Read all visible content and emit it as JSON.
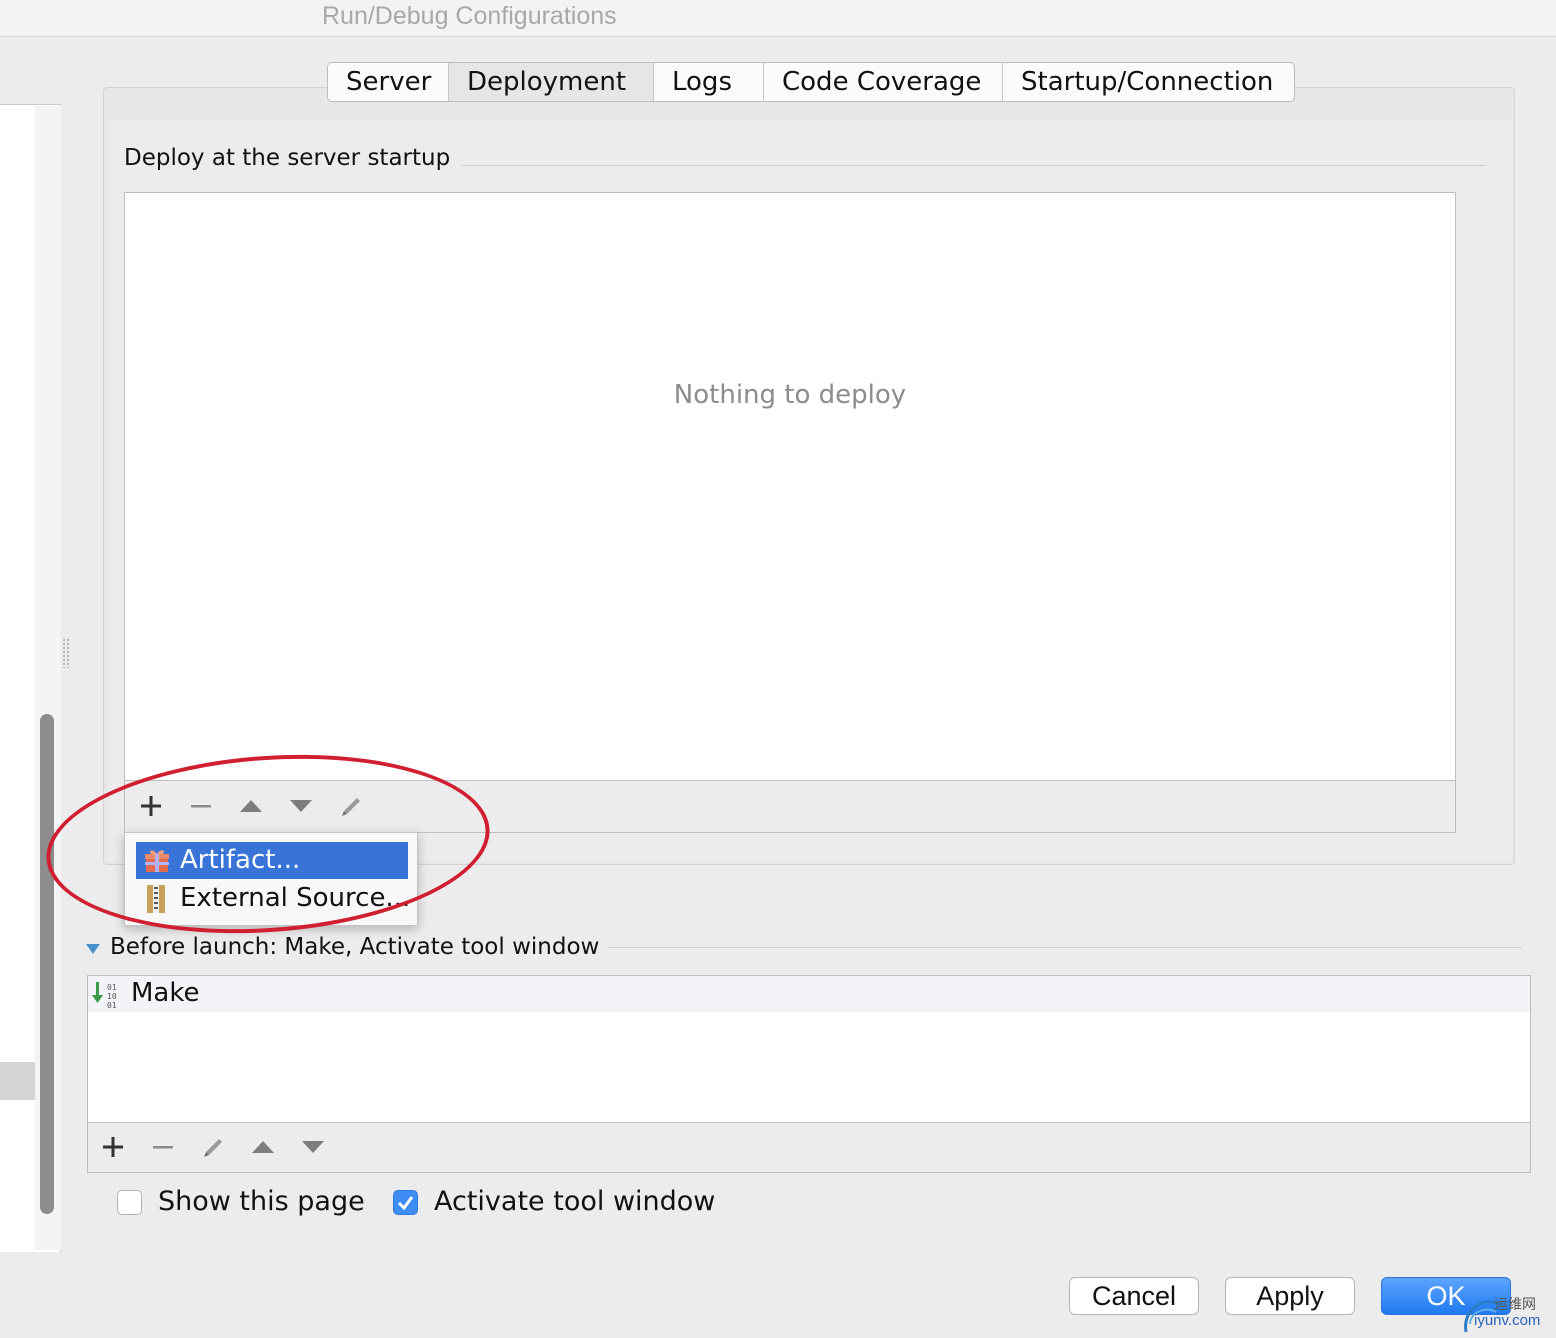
{
  "window": {
    "title": "Run/Debug Configurations"
  },
  "tabs": [
    {
      "label": "Server",
      "selected": false
    },
    {
      "label": "Deployment",
      "selected": true
    },
    {
      "label": "Logs",
      "selected": false
    },
    {
      "label": "Code Coverage",
      "selected": false
    },
    {
      "label": "Startup/Connection",
      "selected": false
    }
  ],
  "deploy": {
    "section_title": "Deploy at the server startup",
    "empty_text": "Nothing to deploy",
    "toolbar_icons": [
      "plus-icon",
      "minus-icon",
      "move-up-icon",
      "move-down-icon",
      "pencil-icon"
    ],
    "add_menu": {
      "items": [
        {
          "label": "Artifact...",
          "icon": "artifact-gift-icon",
          "highlighted": true
        },
        {
          "label": "External Source...",
          "icon": "archive-zip-icon",
          "highlighted": false
        }
      ]
    }
  },
  "before_launch": {
    "title": "Before launch: Make, Activate tool window",
    "items": [
      {
        "label": "Make",
        "icon": "make-build-icon"
      }
    ],
    "toolbar_icons": [
      "plus-icon",
      "minus-icon",
      "pencil-icon",
      "move-up-icon",
      "move-down-icon"
    ]
  },
  "options": {
    "show_page": {
      "label": "Show this page",
      "checked": false
    },
    "activate_tool_window": {
      "label": "Activate tool window",
      "checked": true
    }
  },
  "buttons": {
    "cancel": "Cancel",
    "apply": "Apply",
    "ok": "OK"
  },
  "watermark": {
    "cn": "运维网",
    "url": "iyunv.com"
  },
  "colors": {
    "selection": "#3874d8",
    "primary_button": "#1f7af0",
    "annotation": "#d01f30",
    "checkbox_checked": "#3d8df5"
  }
}
